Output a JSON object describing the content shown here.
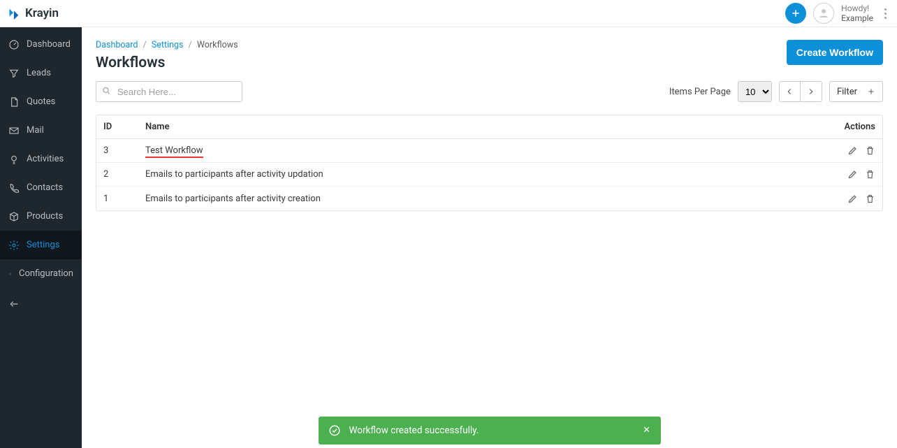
{
  "brand": {
    "name": "Krayin"
  },
  "header": {
    "greeting": "Howdy!",
    "user": "Example"
  },
  "sidebar": {
    "items": [
      {
        "label": "Dashboard"
      },
      {
        "label": "Leads"
      },
      {
        "label": "Quotes"
      },
      {
        "label": "Mail"
      },
      {
        "label": "Activities"
      },
      {
        "label": "Contacts"
      },
      {
        "label": "Products"
      },
      {
        "label": "Settings"
      },
      {
        "label": "Configuration"
      }
    ]
  },
  "breadcrumbs": {
    "dashboard": "Dashboard",
    "settings": "Settings",
    "current": "Workflows"
  },
  "page": {
    "title": "Workflows",
    "create_label": "Create Workflow"
  },
  "toolbar": {
    "search_placeholder": "Search Here...",
    "items_per_page_label": "Items Per Page",
    "per_page_value": "10",
    "filter_label": "Filter"
  },
  "table": {
    "columns": {
      "id": "ID",
      "name": "Name",
      "actions": "Actions"
    },
    "rows": [
      {
        "id": "3",
        "name": "Test Workflow",
        "highlight": true
      },
      {
        "id": "2",
        "name": "Emails to participants after activity updation",
        "highlight": false
      },
      {
        "id": "1",
        "name": "Emails to participants after activity creation",
        "highlight": false
      }
    ]
  },
  "toast": {
    "message": "Workflow created successfully."
  }
}
